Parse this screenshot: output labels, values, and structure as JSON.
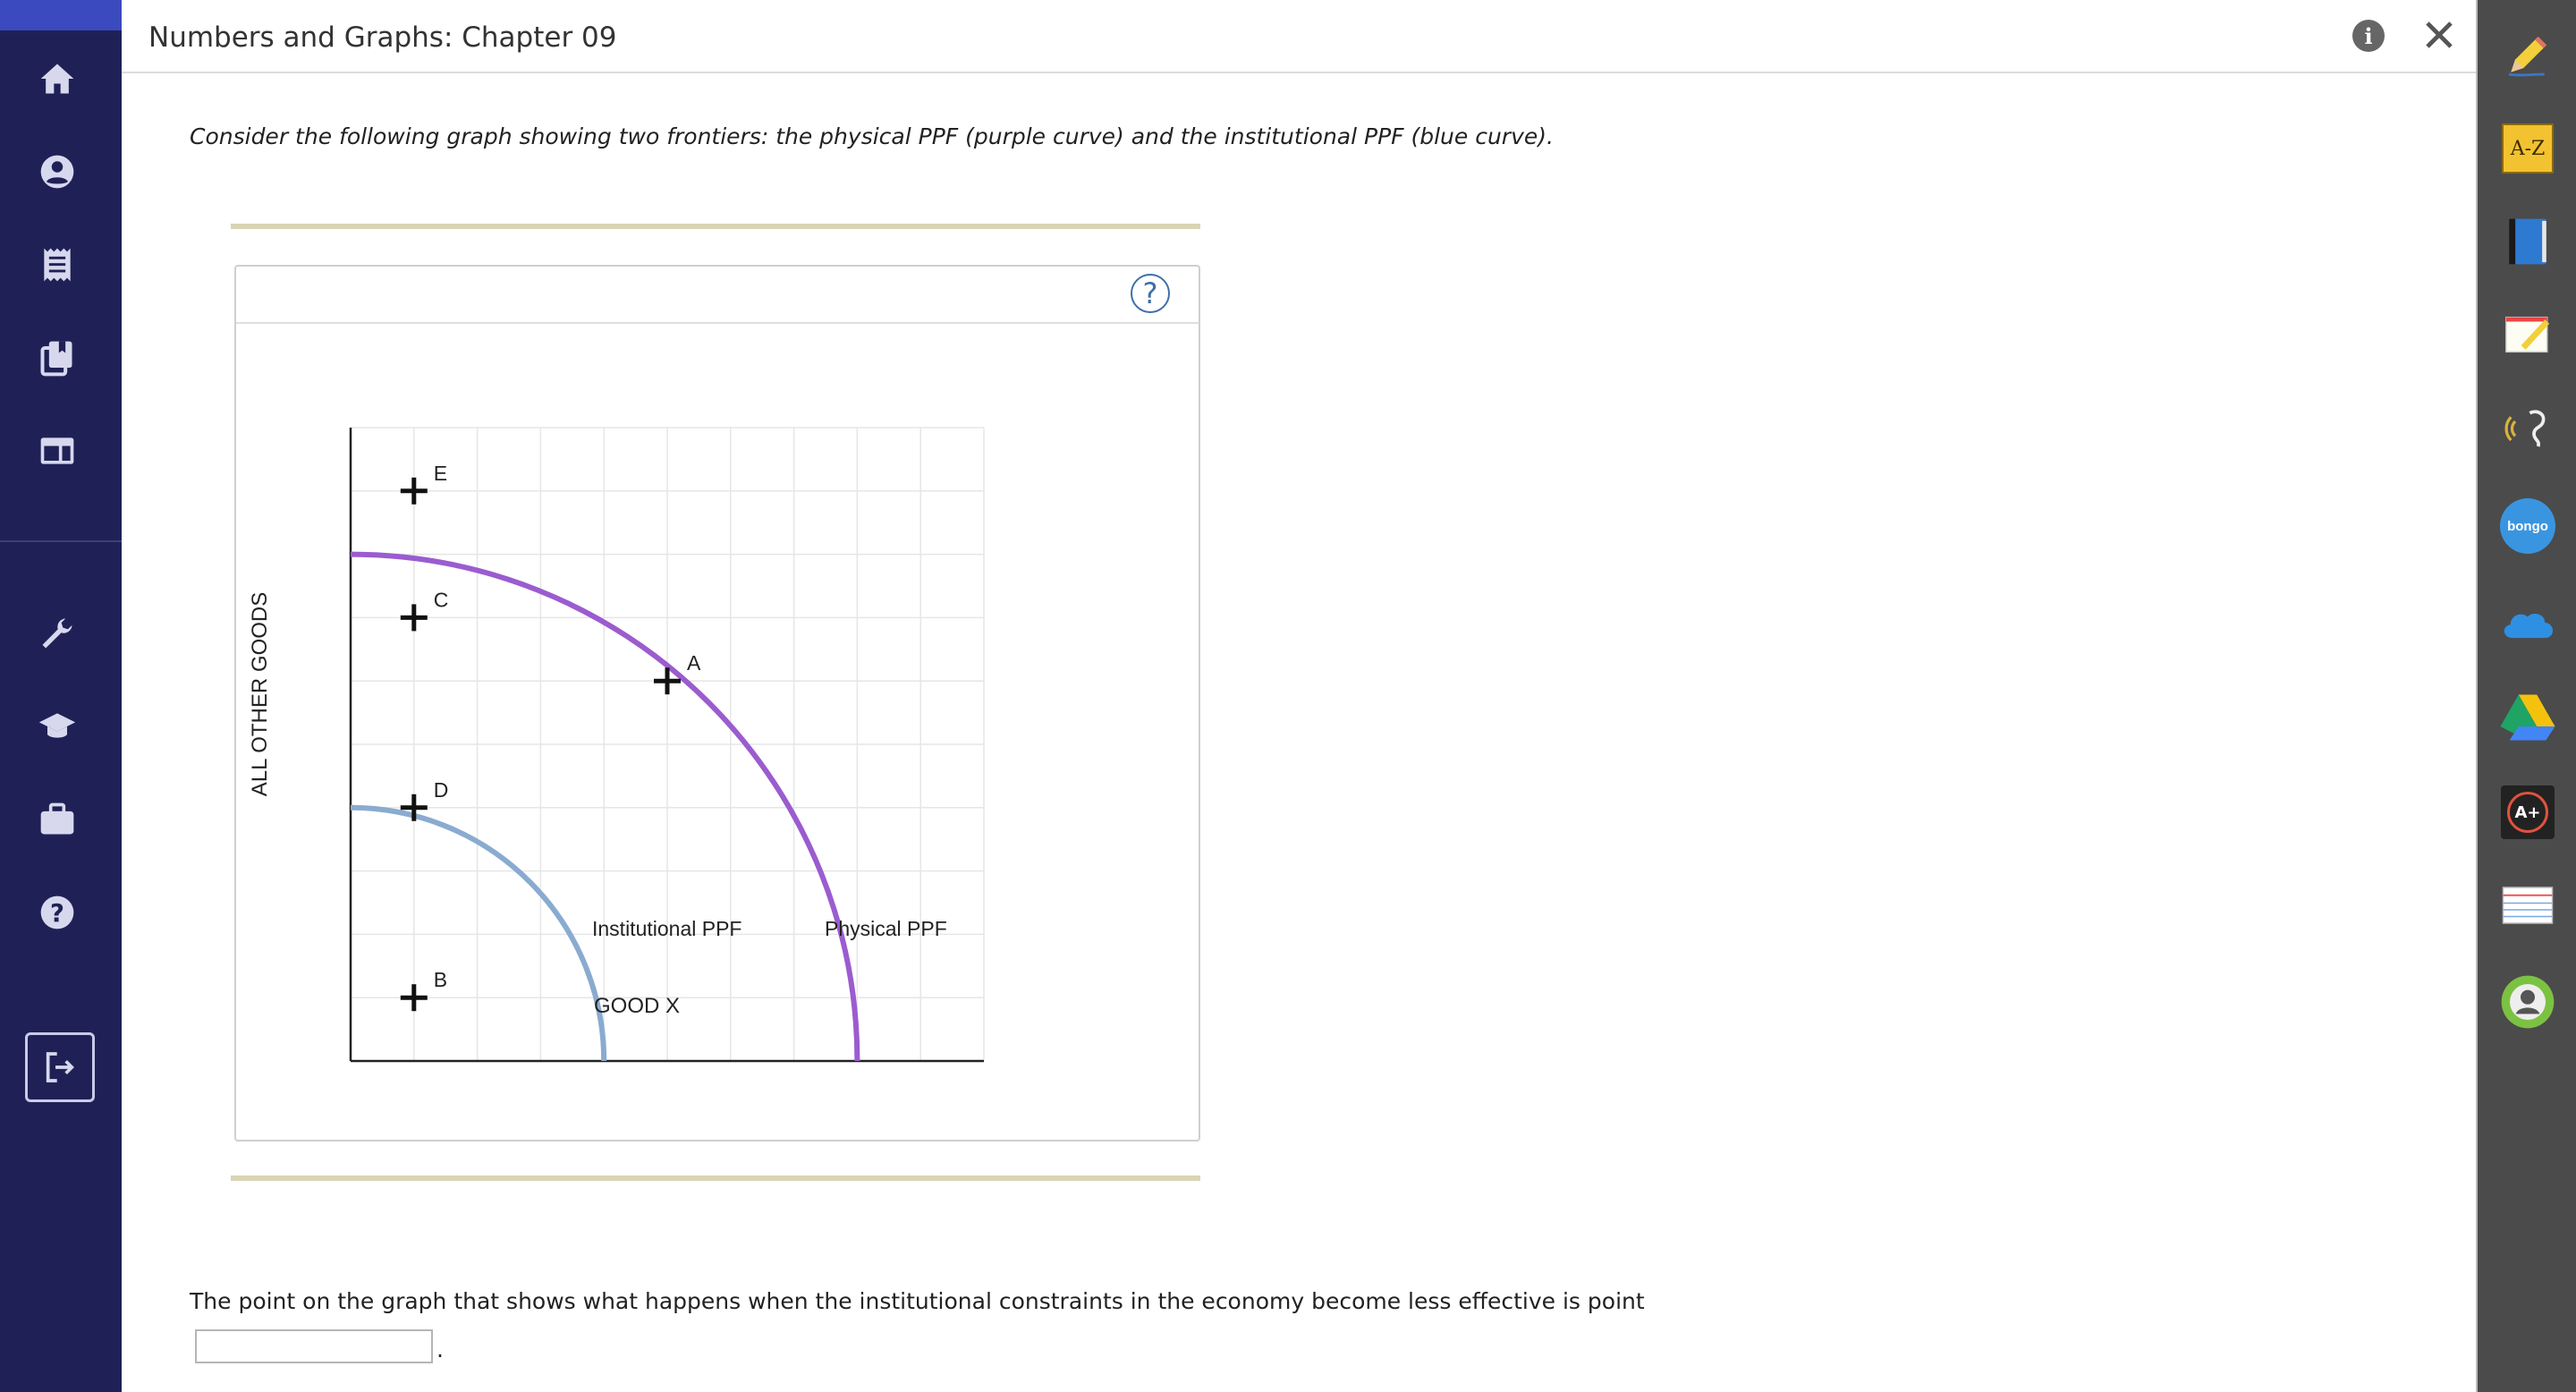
{
  "app": {
    "title": "Numbers and Graphs: Chapter 09"
  },
  "leftnav": {
    "items": [
      {
        "icon": "home-icon"
      },
      {
        "icon": "user-icon"
      },
      {
        "icon": "receipt-icon"
      },
      {
        "icon": "copy-icon"
      },
      {
        "icon": "layout-icon"
      },
      {
        "icon": "wrench-icon"
      },
      {
        "icon": "graduation-cap-icon"
      },
      {
        "icon": "briefcase-icon"
      },
      {
        "icon": "help-icon"
      }
    ],
    "logout_icon": "logout-icon"
  },
  "main": {
    "question": "Consider the following graph showing two frontiers: the physical PPF (purple curve) and the institutional PPF (blue curve).",
    "prompt": "The point on the graph that shows what happens when the institutional constraints in the economy become less effective is point",
    "answer_value": "",
    "period": "."
  },
  "graph": {
    "help_label": "?",
    "ylabel": "ALL OTHER GOODS",
    "xlabel": "GOOD X",
    "institutional_label": "Institutional PPF",
    "physical_label": "Physical PPF",
    "points": [
      {
        "label": "E"
      },
      {
        "label": "C"
      },
      {
        "label": "A"
      },
      {
        "label": "D"
      },
      {
        "label": "B"
      }
    ]
  },
  "chart_data": {
    "type": "line",
    "title": "",
    "xlabel": "GOOD X",
    "ylabel": "ALL OTHER GOODS",
    "grid": true,
    "series": [
      {
        "name": "Physical PPF",
        "color": "#9b5ccf",
        "shape": "concave arc",
        "y_intercept": 8,
        "x_intercept": 8
      },
      {
        "name": "Institutional PPF",
        "color": "#8aabd0",
        "shape": "concave arc",
        "y_intercept": 4,
        "x_intercept": 4
      }
    ],
    "points": [
      {
        "label": "E",
        "x": 1,
        "y": 9
      },
      {
        "label": "C",
        "x": 1,
        "y": 7
      },
      {
        "label": "A",
        "x": 5,
        "y": 6
      },
      {
        "label": "D",
        "x": 1,
        "y": 4
      },
      {
        "label": "B",
        "x": 1,
        "y": 1
      }
    ],
    "xlim": [
      0,
      10
    ],
    "ylim": [
      0,
      10
    ]
  },
  "colors": {
    "nav_bg": "#1f2156",
    "physical_curve": "#9b5ccf",
    "institutional_curve": "#8aabd0",
    "rule": "#d9d4b4",
    "toolbar_bg": "#4b4b4b"
  },
  "toolbar": {
    "tools": [
      {
        "icon": "pencil-icon"
      },
      {
        "icon": "dictionary-icon",
        "text": "A-Z"
      },
      {
        "icon": "book-icon"
      },
      {
        "icon": "notepad-icon"
      },
      {
        "icon": "speech-icon"
      },
      {
        "icon": "bongo-icon",
        "text": "bongo"
      },
      {
        "icon": "onedrive-icon"
      },
      {
        "icon": "google-drive-icon"
      },
      {
        "icon": "grade-icon",
        "text": "A+"
      },
      {
        "icon": "notecard-icon"
      },
      {
        "icon": "profile-circle-icon"
      }
    ]
  }
}
